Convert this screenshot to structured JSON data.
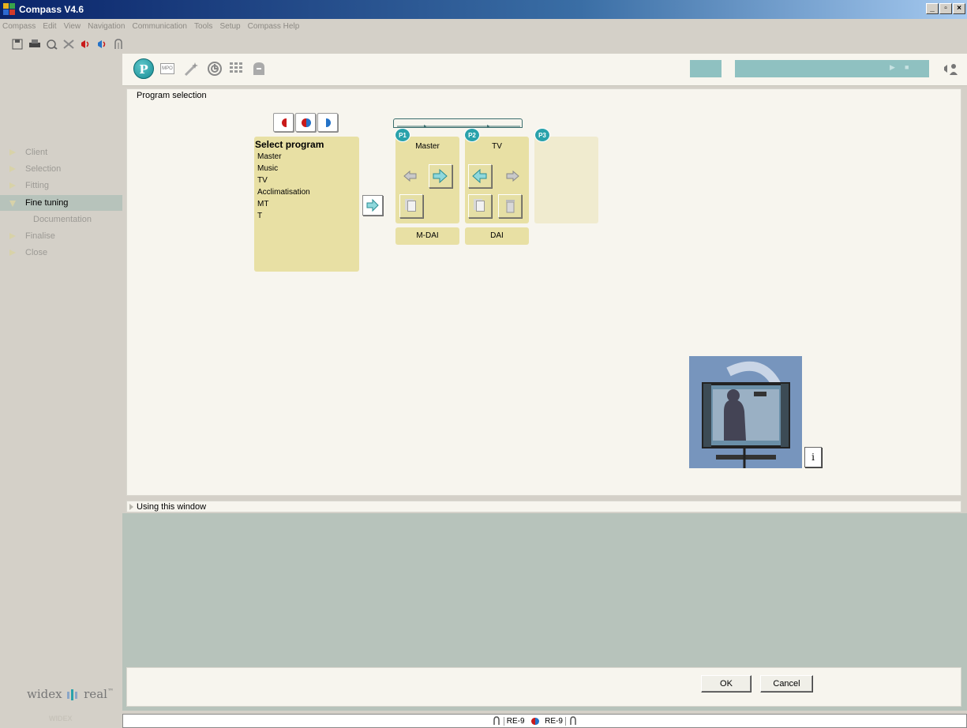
{
  "window": {
    "title": "Compass V4.6",
    "buttons": [
      "_",
      "▫",
      "×"
    ]
  },
  "menubar": [
    "Compass",
    "Edit",
    "View",
    "Navigation",
    "Communication",
    "Tools",
    "Setup",
    "Compass Help"
  ],
  "toolbar_icons": [
    "save-icon",
    "print-icon",
    "print-preview-icon",
    "disconnect-icon",
    "left-ear-sound-icon",
    "binaural-sound-icon",
    "hearing-aid-icon"
  ],
  "sidebar": {
    "items": [
      {
        "label": "Client",
        "state": "inactive"
      },
      {
        "label": "Selection",
        "state": "inactive"
      },
      {
        "label": "Fitting",
        "state": "inactive"
      },
      {
        "label": "Fine tuning",
        "state": "active"
      },
      {
        "label": "Documentation",
        "state": "sub"
      },
      {
        "label": "Finalise",
        "state": "inactive"
      },
      {
        "label": "Close",
        "state": "inactive"
      }
    ],
    "logo_text": "widex",
    "logo_text2": "real",
    "logo_tm": "™",
    "brand_small": "WIDEX"
  },
  "header": {
    "program_icon_letter": "P",
    "mpo_label": "MPO",
    "icons": [
      "program-icon",
      "mpo-icon",
      "magic-wand-icon",
      "target-icon",
      "grid-icon",
      "feedback-icon"
    ],
    "player_controls": [
      "▶",
      "■"
    ]
  },
  "main": {
    "title": "Program selection",
    "select_program": {
      "title": "Select program",
      "options": [
        "Master",
        "Music",
        "TV",
        "Acclimatisation",
        "MT",
        "T"
      ]
    },
    "slots": [
      {
        "badge": "P1",
        "label": "Master",
        "dai": "M-DAI"
      },
      {
        "badge": "P2",
        "label": "TV",
        "dai": "DAI"
      },
      {
        "badge": "P3",
        "label": "",
        "dai": ""
      }
    ],
    "info_button": "i"
  },
  "using_window": {
    "label": "Using this window"
  },
  "buttons": {
    "ok": "OK",
    "cancel": "Cancel"
  },
  "status": {
    "left_device": "RE-9",
    "right_device": "RE-9"
  },
  "colors": {
    "accent_teal": "#2aa2ab",
    "panel_yellow": "#e8e0a4",
    "left_ear": "#c91a1a",
    "right_ear": "#2472c7"
  }
}
